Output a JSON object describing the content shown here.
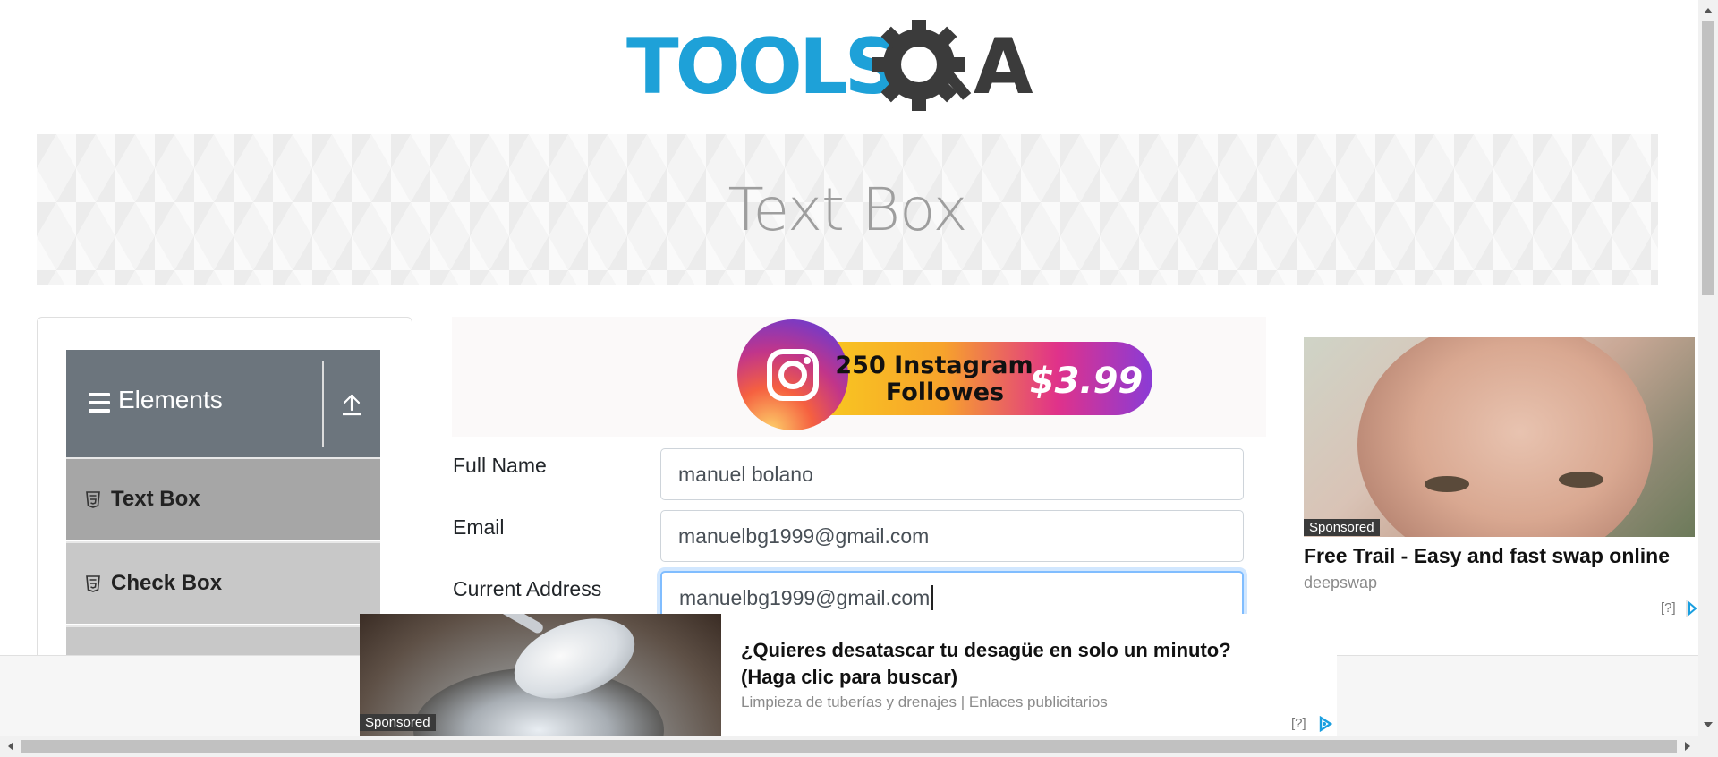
{
  "logo": {
    "part1": "TOOLS",
    "part2": "A",
    "brand_blue": "#1ea1d8",
    "brand_dark": "#3b3b3b"
  },
  "banner": {
    "title": "Text Box"
  },
  "sidebar": {
    "group_title": "Elements",
    "items": [
      {
        "label": "Text Box",
        "icon": "html5-icon",
        "active": true
      },
      {
        "label": "Check Box",
        "icon": "html5-icon",
        "active": false
      }
    ]
  },
  "top_ad": {
    "line1": "250 Instagram",
    "line2": "Followes",
    "price": "$3.99"
  },
  "form": {
    "full_name": {
      "label": "Full Name",
      "value": "manuel bolano"
    },
    "email": {
      "label": "Email",
      "value": "manuelbg1999@gmail.com"
    },
    "current_address": {
      "label": "Current Address",
      "value": "manuelbg1999@gmail.com"
    }
  },
  "right_ad": {
    "sponsored": "Sponsored",
    "title": "Free Trail - Easy and fast swap online",
    "source": "deepswap",
    "help": "[?]"
  },
  "bottom_ad": {
    "sponsored": "Sponsored",
    "title_line1": "¿Quieres desatascar tu desagüe en solo un minuto?",
    "title_line2": "(Haga clic para buscar)",
    "source": "Limpieza de tuberías y drenajes | Enlaces publicitarios",
    "help": "[?]"
  },
  "colors": {
    "sidebar_header": "#6c757d",
    "active_item": "#a6a6a6",
    "item": "#c8c8c8",
    "focus": "#80bdff"
  }
}
